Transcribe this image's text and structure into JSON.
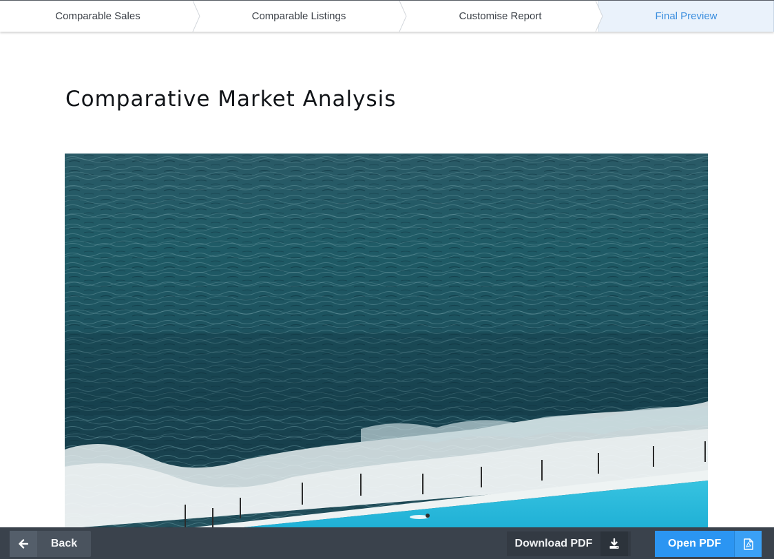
{
  "stepper": {
    "steps": [
      {
        "label": "Comparable Sales",
        "active": false
      },
      {
        "label": "Comparable Listings",
        "active": false
      },
      {
        "label": "Customise Report",
        "active": false
      },
      {
        "label": "Final Preview",
        "active": true
      }
    ],
    "active_color": "#3b8ede"
  },
  "report": {
    "title": "Comparative Market Analysis",
    "cover_image": "ocean-pool-photo"
  },
  "footer": {
    "back_label": "Back",
    "back_icon": "arrow-left-icon",
    "download_label": "Download PDF",
    "download_icon": "download-icon",
    "open_label": "Open PDF",
    "open_icon": "pdf-file-icon",
    "open_color": "#2b95f2"
  }
}
